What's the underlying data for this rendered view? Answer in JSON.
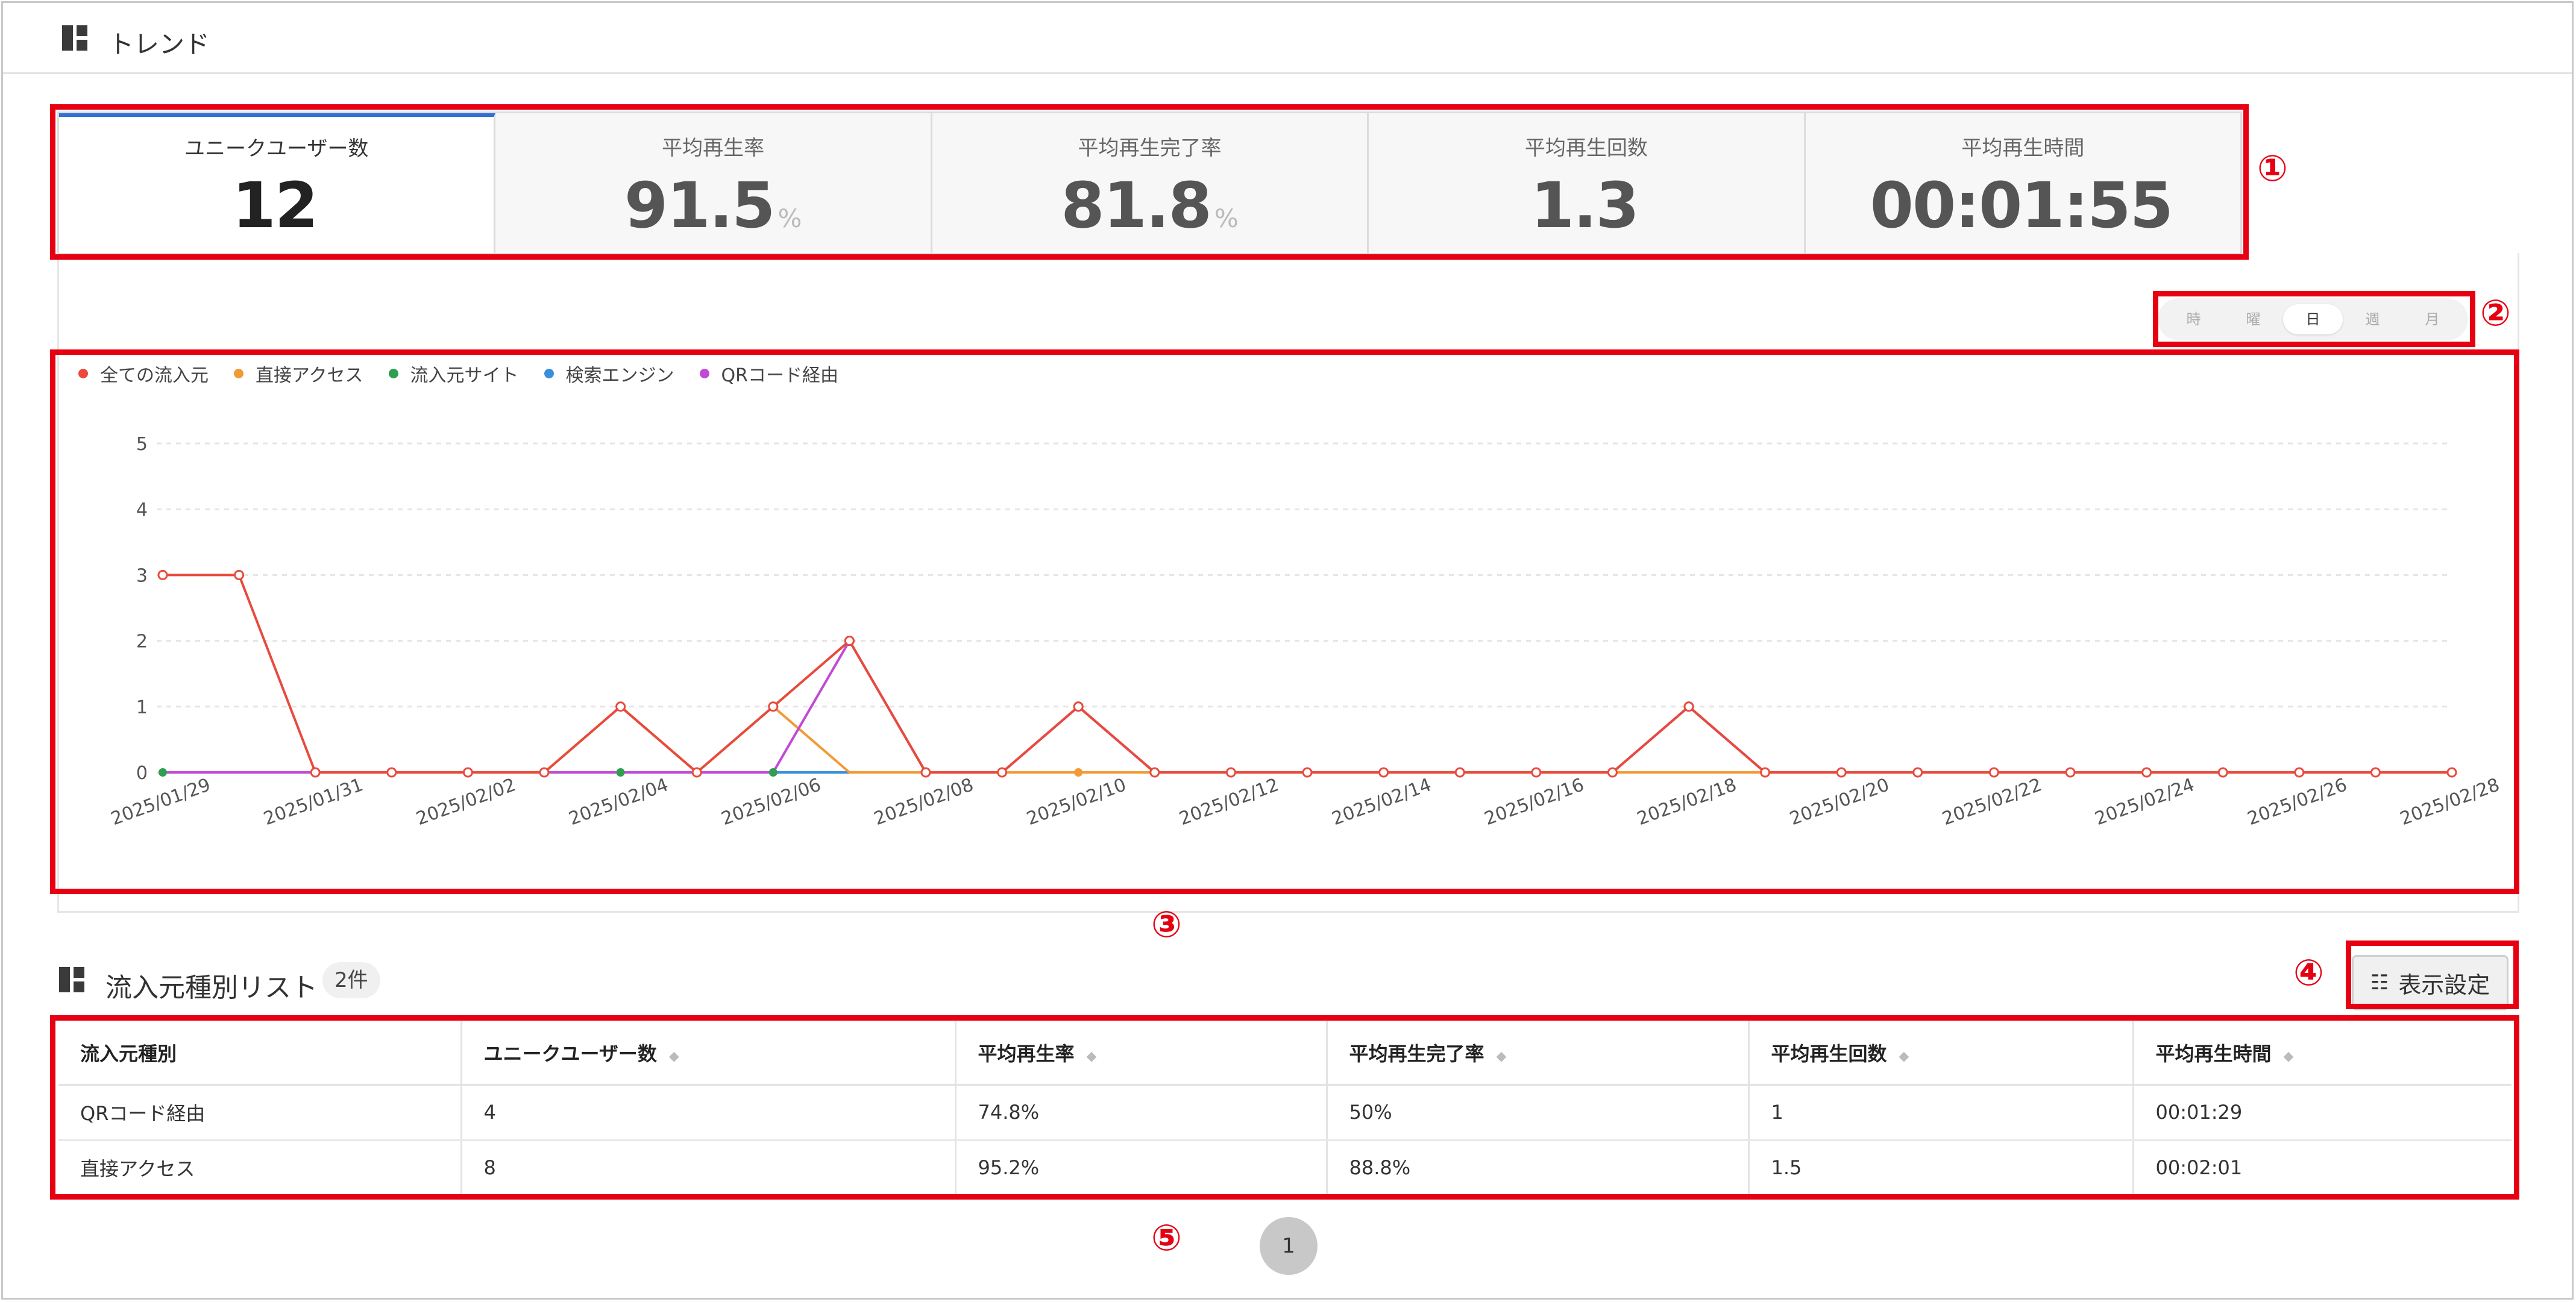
{
  "header": {
    "title": "トレンド"
  },
  "metric_tabs": [
    {
      "label": "ユニークユーザー数",
      "value": "12",
      "unit": ""
    },
    {
      "label": "平均再生率",
      "value": "91.5",
      "unit": "%"
    },
    {
      "label": "平均再生完了率",
      "value": "81.8",
      "unit": "%"
    },
    {
      "label": "平均再生回数",
      "value": "1.3",
      "unit": ""
    },
    {
      "label": "平均再生時間",
      "value": "00:01:55",
      "unit": ""
    }
  ],
  "granularity": {
    "options": [
      "時",
      "曜",
      "日",
      "週",
      "月"
    ],
    "selected": "日"
  },
  "chart_data": {
    "type": "line",
    "title": "",
    "xlabel": "",
    "ylabel": "",
    "ylim": [
      0,
      5
    ],
    "yticks": [
      0,
      1,
      2,
      3,
      4,
      5
    ],
    "grid": true,
    "legend_position": "top-left",
    "x": [
      "2025/01/29",
      "2025/01/30",
      "2025/01/31",
      "2025/02/01",
      "2025/02/02",
      "2025/02/03",
      "2025/02/04",
      "2025/02/05",
      "2025/02/06",
      "2025/02/07",
      "2025/02/08",
      "2025/02/09",
      "2025/02/10",
      "2025/02/11",
      "2025/02/12",
      "2025/02/13",
      "2025/02/14",
      "2025/02/15",
      "2025/02/16",
      "2025/02/17",
      "2025/02/18",
      "2025/02/19",
      "2025/02/20",
      "2025/02/21",
      "2025/02/22",
      "2025/02/23",
      "2025/02/24",
      "2025/02/25",
      "2025/02/26",
      "2025/02/27",
      "2025/02/28"
    ],
    "x_tick_labels": [
      "2025/01/29",
      "2025/01/31",
      "2025/02/02",
      "2025/02/04",
      "2025/02/06",
      "2025/02/08",
      "2025/02/10",
      "2025/02/12",
      "2025/02/14",
      "2025/02/16",
      "2025/02/18",
      "2025/02/20",
      "2025/02/22",
      "2025/02/24",
      "2025/02/26",
      "2025/02/28"
    ],
    "series": [
      {
        "name": "全ての流入元",
        "color": "#e84a3c",
        "values": [
          3,
          3,
          0,
          0,
          0,
          0,
          1,
          0,
          1,
          2,
          0,
          0,
          1,
          0,
          0,
          0,
          0,
          0,
          0,
          0,
          1,
          0,
          0,
          0,
          0,
          0,
          0,
          0,
          0,
          0,
          0
        ]
      },
      {
        "name": "直接アクセス",
        "color": "#f29a38",
        "values": [
          0,
          0,
          0,
          0,
          0,
          0,
          1,
          0,
          1,
          0,
          0,
          0,
          0,
          0,
          0,
          0,
          0,
          0,
          0,
          0,
          0,
          0,
          0,
          0,
          0,
          0,
          0,
          0,
          0,
          0,
          0
        ]
      },
      {
        "name": "流入元サイト",
        "color": "#2e9e4f",
        "values": [
          0,
          0,
          0,
          0,
          0,
          0,
          0,
          0,
          0,
          0,
          0,
          0,
          0,
          0,
          0,
          0,
          0,
          0,
          0,
          0,
          0,
          0,
          0,
          0,
          0,
          0,
          0,
          0,
          0,
          0,
          0
        ]
      },
      {
        "name": "検索エンジン",
        "color": "#3a8fd9",
        "values": [
          0,
          0,
          0,
          0,
          0,
          0,
          0,
          0,
          0,
          0,
          0,
          0,
          0,
          0,
          0,
          0,
          0,
          0,
          0,
          0,
          0,
          0,
          0,
          0,
          0,
          0,
          0,
          0,
          0,
          0,
          0
        ]
      },
      {
        "name": "QRコード経由",
        "color": "#c04ad4",
        "values": [
          0,
          0,
          0,
          0,
          0,
          0,
          0,
          0,
          0,
          2,
          0,
          0,
          1,
          0,
          0,
          0,
          0,
          0,
          0,
          0,
          1,
          0,
          0,
          0,
          0,
          0,
          0,
          0,
          0,
          0,
          0
        ]
      }
    ]
  },
  "list_section": {
    "title": "流入元種別リスト",
    "count": "2件",
    "settings_label": "表示設定",
    "columns": [
      "流入元種別",
      "ユニークユーザー数",
      "平均再生率",
      "平均再生完了率",
      "平均再生回数",
      "平均再生時間"
    ],
    "rows": [
      [
        "QRコード経由",
        "4",
        "74.8%",
        "50%",
        "1",
        "00:01:29"
      ],
      [
        "直接アクセス",
        "8",
        "95.2%",
        "88.8%",
        "1.5",
        "00:02:01"
      ]
    ]
  },
  "pagination": {
    "current": "1"
  },
  "annotations": [
    "①",
    "②",
    "③",
    "④",
    "⑤"
  ]
}
